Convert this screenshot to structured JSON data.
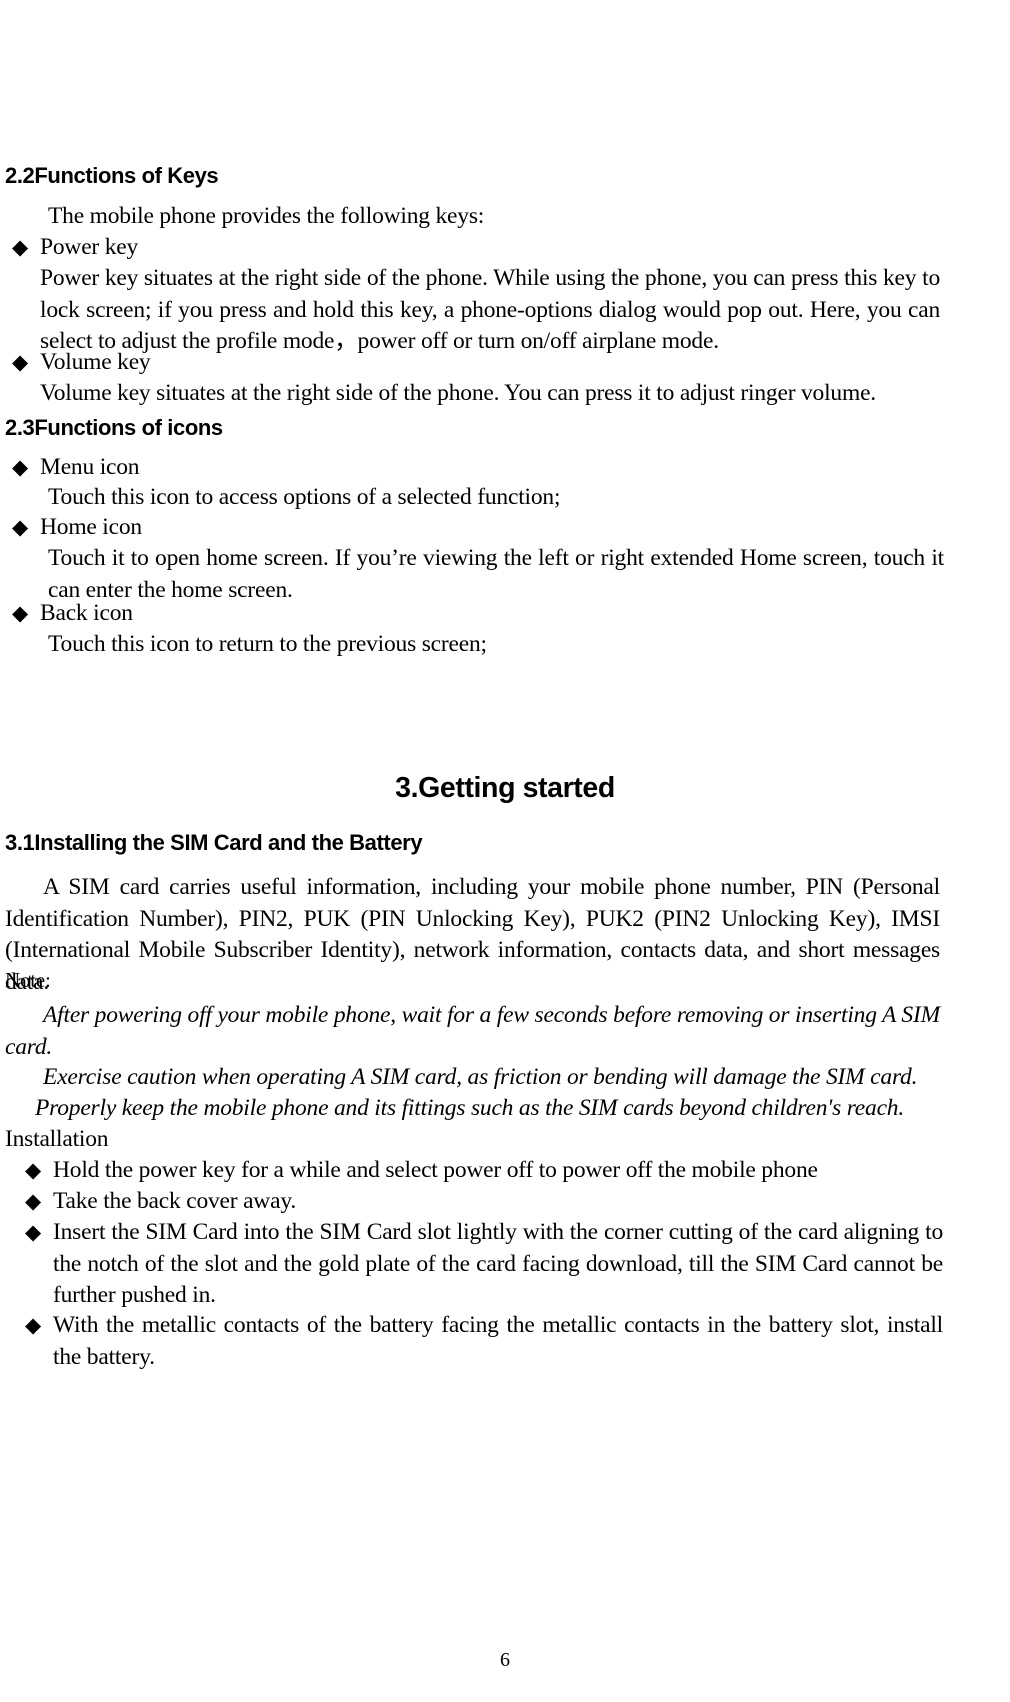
{
  "page": {
    "number": "6",
    "background_color": "#ffffff",
    "text_color": "#000000"
  },
  "sections": [
    {
      "id": "functions-of-keys",
      "heading": "2.2Functions of Keys",
      "intro": "The mobile phone provides the following keys:",
      "items": [
        {
          "bullet": "◆",
          "title": "Power key",
          "body": "Power key situates at the right side of the phone. While using the phone, you can press this key to lock screen; if you press and hold this key, a phone-options dialog would pop out. Here, you can select to adjust the profile mode，power off or turn on/off airplane mode."
        },
        {
          "bullet": "◆",
          "title": "Volume key",
          "body": "Volume key situates at the right side of the phone. You can press it to adjust ringer volume."
        }
      ]
    },
    {
      "id": "functions-of-icons",
      "heading": "2.3Functions of icons",
      "items": [
        {
          "bullet": "◆",
          "title": "Menu icon",
          "body": "Touch this icon to access options of a selected function;"
        },
        {
          "bullet": "◆",
          "title": "Home icon",
          "body": "Touch it to open home screen. If you’re viewing the left or right extended Home screen, touch it can enter the home screen."
        },
        {
          "bullet": "◆",
          "title": "Back icon",
          "body": "Touch this icon to return to the previous screen;"
        }
      ]
    }
  ],
  "chapter": {
    "title": "3.Getting started",
    "section_heading": "3.1Installing the SIM Card and the Battery",
    "intro_paragraph": "A SIM card carries useful information, including your mobile phone number, PIN (Personal Identification Number), PIN2, PUK (PIN Unlocking Key), PUK2 (PIN2 Unlocking Key), IMSI (International Mobile Subscriber Identity), network information, contacts data, and short messages data.",
    "note_label": "Note:",
    "notes": [
      "After powering off your mobile phone, wait for a few seconds before removing or inserting A SIM card.",
      "Exercise caution when operating A SIM card, as friction or bending will damage the SIM card.",
      "Properly keep the mobile phone and its fittings such as the SIM cards beyond children's reach."
    ],
    "installation_label": "Installation",
    "installation_steps": [
      {
        "bullet": "◆",
        "text": "Hold the power key for a while and select power off to power off the mobile phone"
      },
      {
        "bullet": "◆",
        "text": "Take the back cover away."
      },
      {
        "bullet": "◆",
        "text": "Insert the SIM Card into the SIM Card slot lightly with the corner cutting of the card aligning to the notch of the slot and the gold plate of the card facing download, till the SIM Card cannot be further pushed in."
      },
      {
        "bullet": "◆",
        "text": "With the metallic contacts of the battery facing the metallic contacts in the battery slot, install the battery."
      }
    ]
  }
}
